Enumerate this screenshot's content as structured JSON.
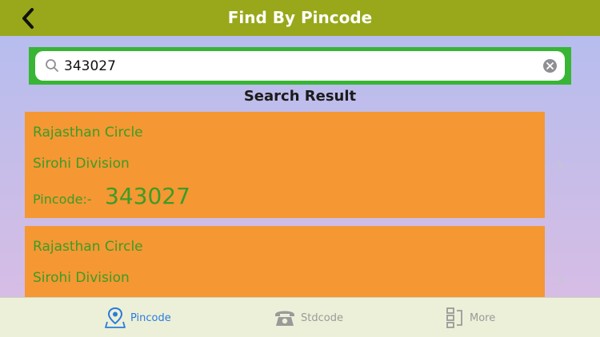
{
  "header": {
    "title": "Find By Pincode",
    "back_icon": "chevron-left-icon"
  },
  "search": {
    "value": "343027",
    "placeholder": "",
    "icon": "search-icon",
    "clear_icon": "clear-icon"
  },
  "results_title": "Search Result",
  "results": [
    {
      "circle": "Rajasthan Circle",
      "division": "Sirohi Division",
      "pincode_label": "Pincode:-",
      "pincode": "343027"
    },
    {
      "circle": "Rajasthan Circle",
      "division": "Sirohi Division"
    }
  ],
  "tabs": [
    {
      "label": "Pincode",
      "icon": "map-pin-icon",
      "active": true
    },
    {
      "label": "Stdcode",
      "icon": "telephone-icon",
      "active": false
    },
    {
      "label": "More",
      "icon": "more-icon",
      "active": false
    }
  ],
  "colors": {
    "navbar": "#98a81a",
    "search_border": "#38b534",
    "card": "#f59733",
    "card_text": "#3a9d25",
    "tab_active": "#2a7bdc",
    "tab_inactive": "#9a9a9a"
  }
}
